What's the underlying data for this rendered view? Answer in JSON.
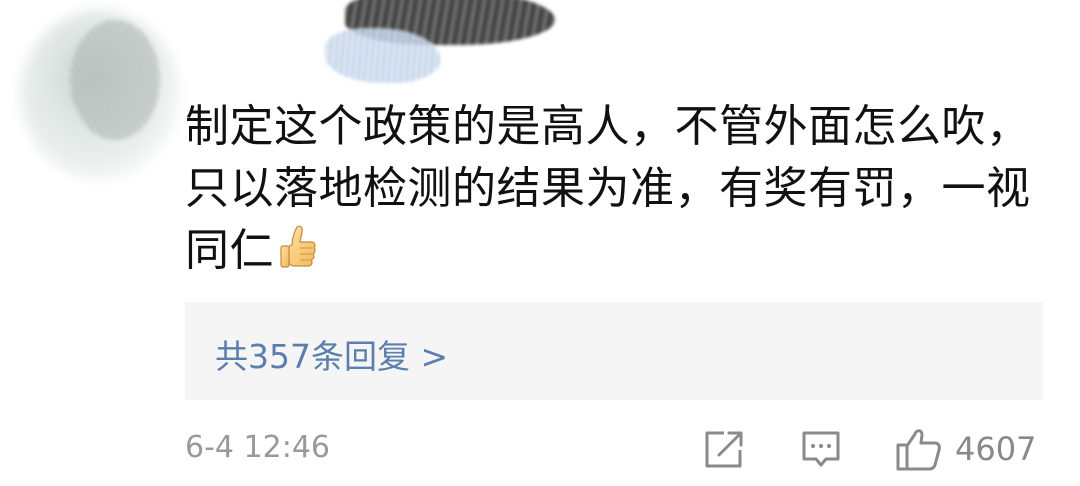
{
  "comment": {
    "text": "制定这个政策的是高人，不管外面怎么吹，只以落地检测的结果为准，有奖有罚，一视同仁",
    "emoji": "thumbs-up-emoji"
  },
  "replies": {
    "label": "共357条回复 >"
  },
  "footer": {
    "timestamp": "6-4 12:46",
    "like_count": "4607"
  },
  "icons": {
    "share": "share-icon",
    "comment": "comment-icon",
    "like": "thumbs-up-icon"
  },
  "colors": {
    "link": "#5a7fae",
    "meta": "#999999"
  }
}
